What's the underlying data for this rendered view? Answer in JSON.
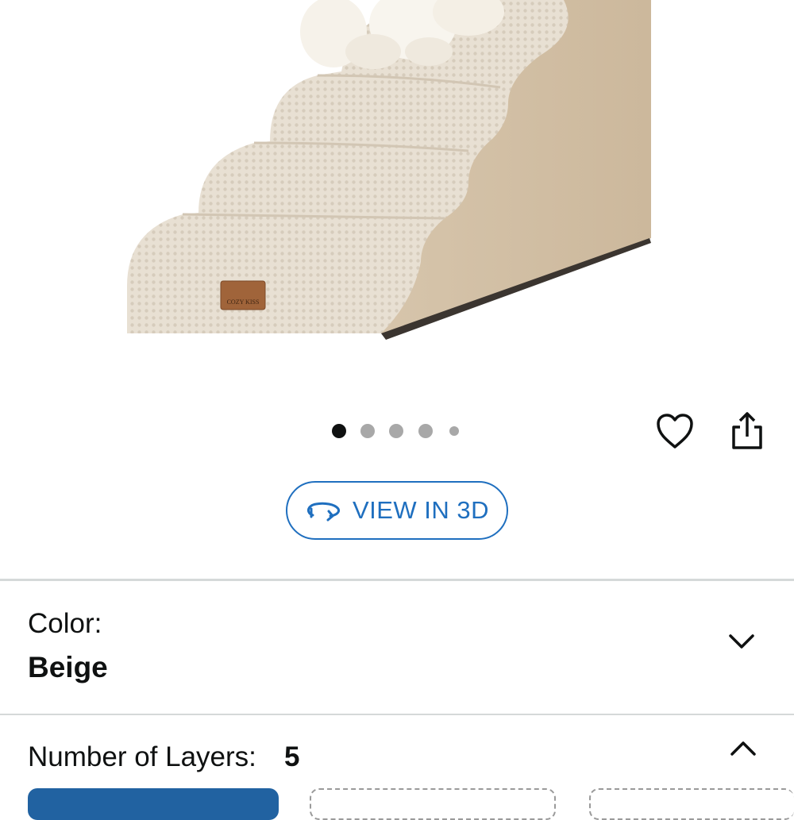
{
  "product_image": {
    "alt": "Beige dog stairs with dog",
    "tag_text": "COZY KISS"
  },
  "carousel": {
    "total": 5,
    "active_index": 0
  },
  "icons": {
    "wishlist": "heart-outline-icon",
    "share": "share-icon",
    "view3d": "rotate-3d-icon",
    "color_toggle": "chevron-down-icon",
    "layers_toggle": "chevron-up-icon"
  },
  "view3d": {
    "label": "VIEW IN 3D"
  },
  "variation": {
    "color": {
      "label": "Color:",
      "value": "Beige"
    },
    "layers": {
      "label": "Number of Layers:",
      "value": "5"
    }
  },
  "colors": {
    "accent": "#1f6fbf",
    "selected_option": "#2162a1",
    "divider": "#d5d9d9"
  }
}
